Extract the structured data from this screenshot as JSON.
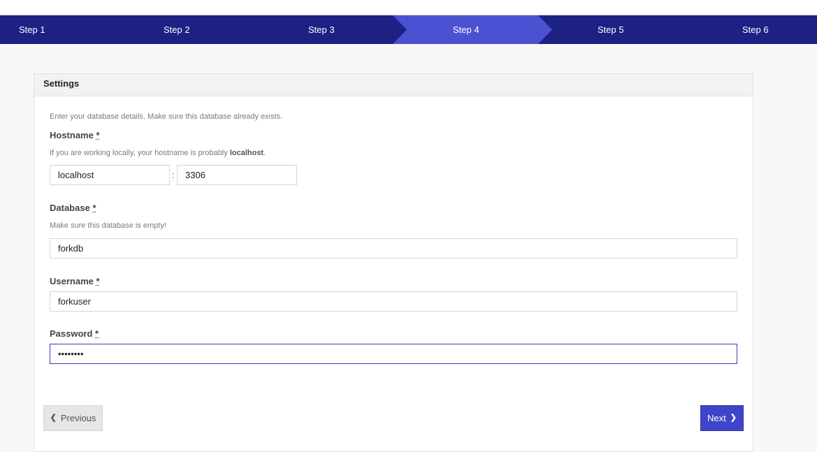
{
  "steps": [
    "Step 1",
    "Step 2",
    "Step 3",
    "Step 4",
    "Step 5",
    "Step 6"
  ],
  "active_step": 4,
  "panel": {
    "title": "Settings",
    "intro": "Enter your database details. Make sure this database already exists."
  },
  "hostname": {
    "label": "Hostname",
    "required_mark": "*",
    "help_prefix": "If you are working locally, your hostname is probably ",
    "help_bold": "localhost",
    "help_suffix": ".",
    "value": "localhost",
    "port_separator": ":",
    "port_value": "3306"
  },
  "database": {
    "label": "Database",
    "required_mark": "*",
    "help": "Make sure this database is empty!",
    "value": "forkdb"
  },
  "username": {
    "label": "Username",
    "required_mark": "*",
    "value": "forkuser"
  },
  "password": {
    "label": "Password",
    "required_mark": "*",
    "value": "forkuser"
  },
  "buttons": {
    "previous": "Previous",
    "next": "Next"
  },
  "colors": {
    "step_bar": "#1d2184",
    "active_step": "#4b52d1",
    "next_button": "#4044c8"
  }
}
